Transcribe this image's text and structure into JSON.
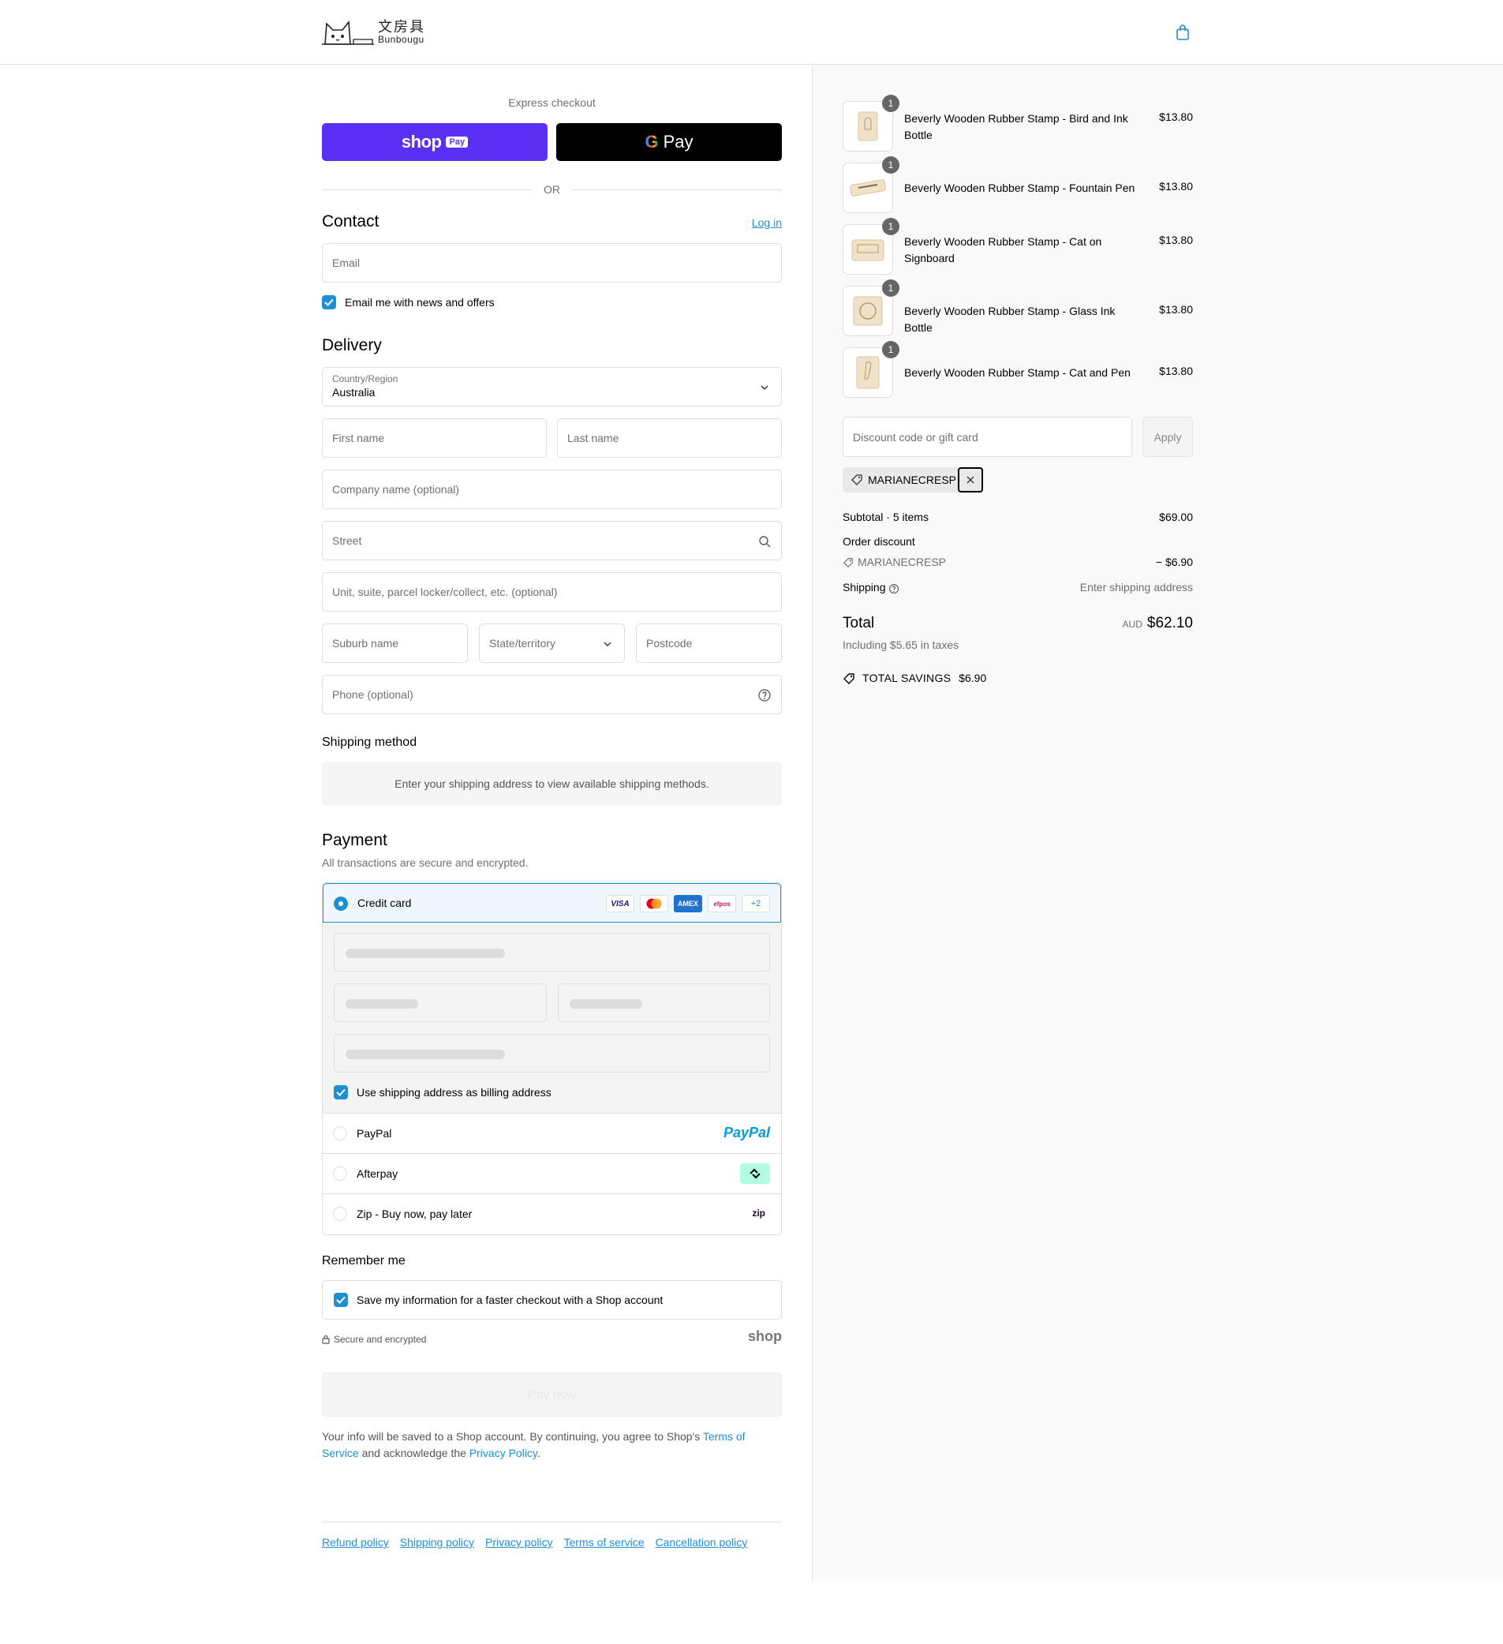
{
  "header": {
    "logo_cjk": "文房具",
    "logo_latin": "Bunbougu"
  },
  "express": {
    "title": "Express checkout",
    "shop_label": "shop",
    "shop_pay_badge": "Pay",
    "gpay_label": "Pay",
    "or": "OR"
  },
  "contact": {
    "title": "Contact",
    "login": "Log in",
    "email_placeholder": "Email",
    "news_label": "Email me with news and offers"
  },
  "delivery": {
    "title": "Delivery",
    "country_label": "Country/Region",
    "country_value": "Australia",
    "first_name": "First name",
    "last_name": "Last name",
    "company": "Company name (optional)",
    "street": "Street",
    "unit": "Unit, suite, parcel locker/collect, etc. (optional)",
    "suburb": "Suburb name",
    "state": "State/territory",
    "postcode": "Postcode",
    "phone": "Phone (optional)"
  },
  "shipping_method": {
    "title": "Shipping method",
    "message": "Enter your shipping address to view available shipping methods."
  },
  "payment": {
    "title": "Payment",
    "subtitle": "All transactions are secure and encrypted.",
    "credit_card": "Credit card",
    "cards": [
      "VISA",
      "MC",
      "AMEX",
      "efpos",
      "+2"
    ],
    "billing_label": "Use shipping address as billing address",
    "paypal": "PayPal",
    "paypal_logo": "PayPal",
    "afterpay": "Afterpay",
    "zip": "Zip - Buy now, pay later",
    "zip_logo": "zip"
  },
  "remember": {
    "title": "Remember me",
    "save_label": "Save my information for a faster checkout with a Shop account",
    "secure": "Secure and encrypted",
    "shop_logo": "shop"
  },
  "pay_now": "Pay now",
  "legal": {
    "text1": "Your info will be saved to a Shop account. By continuing, you agree to Shop's ",
    "tos": "Terms of Service",
    "text2": " and acknowledge the ",
    "privacy": "Privacy Policy",
    "text3": "."
  },
  "footer": {
    "links": [
      "Refund policy",
      "Shipping policy",
      "Privacy policy",
      "Terms of service",
      "Cancellation policy"
    ]
  },
  "order": {
    "items": [
      {
        "qty": "1",
        "name": "Beverly Wooden Rubber Stamp - Bird and Ink Bottle",
        "price": "$13.80"
      },
      {
        "qty": "1",
        "name": "Beverly Wooden Rubber Stamp - Fountain Pen",
        "price": "$13.80"
      },
      {
        "qty": "1",
        "name": "Beverly Wooden Rubber Stamp - Cat on Signboard",
        "price": "$13.80"
      },
      {
        "qty": "1",
        "name": "Beverly Wooden Rubber Stamp - Glass Ink Bottle",
        "price": "$13.80"
      },
      {
        "qty": "1",
        "name": "Beverly Wooden Rubber Stamp - Cat and Pen",
        "price": "$13.80"
      }
    ],
    "discount_placeholder": "Discount code or gift card",
    "apply": "Apply",
    "code": "MARIANECRESP",
    "subtotal_label": "Subtotal · 5 items",
    "subtotal": "$69.00",
    "order_discount_label": "Order discount",
    "discount_code": "MARIANECRESP",
    "discount_amount": "− $6.90",
    "shipping_label": "Shipping",
    "shipping_value": "Enter shipping address",
    "total_label": "Total",
    "currency": "AUD",
    "total": "$62.10",
    "taxes": "Including $5.65 in taxes",
    "savings_label": "TOTAL SAVINGS",
    "savings": "$6.90"
  },
  "colors": {
    "accent": "#1f8fd1",
    "shop_purple": "#5a31f4",
    "afterpay_mint": "#b2fce4"
  }
}
